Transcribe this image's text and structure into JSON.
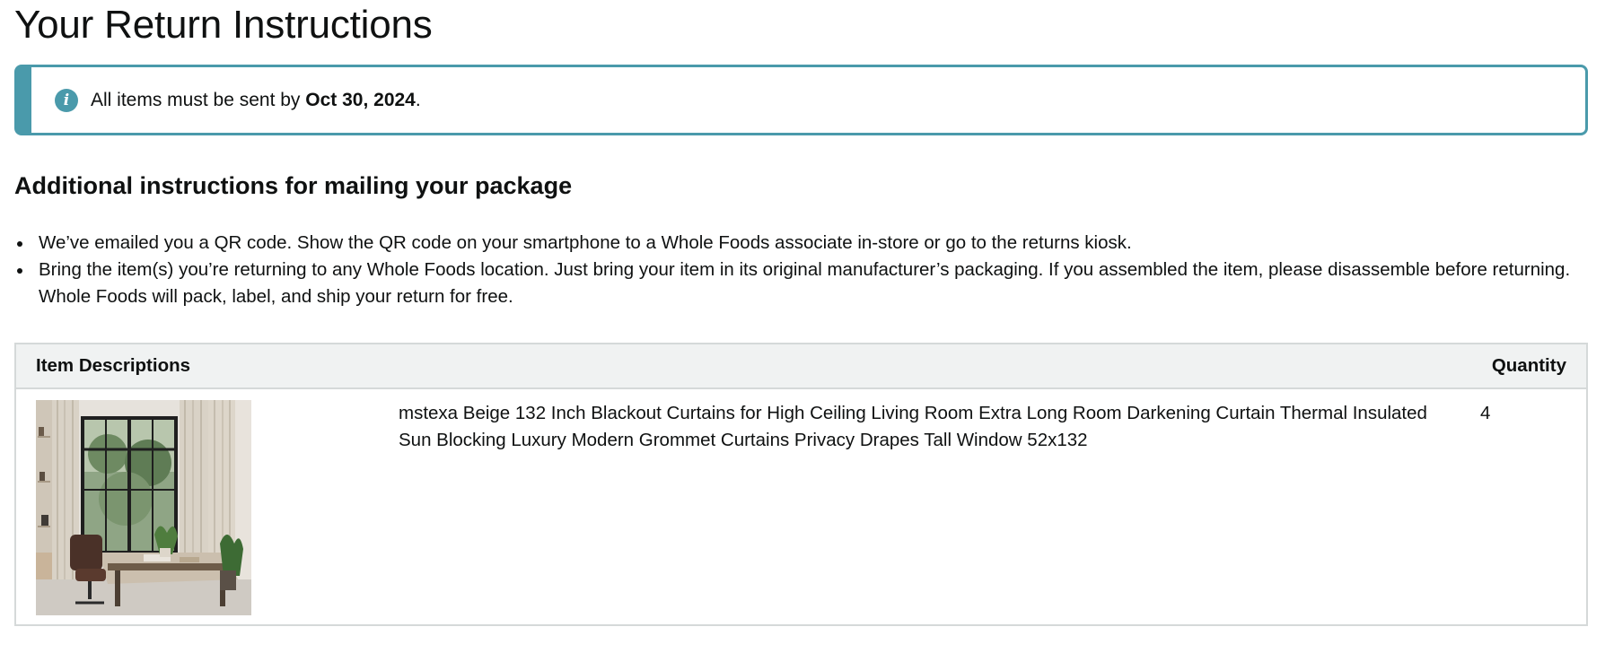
{
  "page": {
    "title": "Your Return Instructions"
  },
  "alert": {
    "icon": "info-icon",
    "text_prefix": "All items must be sent by ",
    "deadline": "Oct 30, 2024",
    "text_suffix": ".",
    "accent_color": "#4a9aab"
  },
  "instructions": {
    "heading": "Additional instructions for mailing your package",
    "items": [
      "We’ve emailed you a QR code. Show the QR code on your smartphone to a Whole Foods associate in-store or go to the returns kiosk.",
      "Bring the item(s) you’re returning to any Whole Foods location. Just bring your item in its original manufacturer’s packaging. If you assembled the item, please disassemble before returning. Whole Foods will pack, label, and ship your return for free."
    ]
  },
  "table": {
    "headers": {
      "description": "Item Descriptions",
      "quantity": "Quantity"
    },
    "rows": [
      {
        "image": "product-image-curtains-room",
        "description": "mstexa Beige 132 Inch Blackout Curtains for High Ceiling Living Room Extra Long Room Darkening Curtain Thermal Insulated Sun Blocking Luxury Modern Grommet Curtains Privacy Drapes Tall Window 52x132",
        "quantity": "4"
      }
    ]
  }
}
